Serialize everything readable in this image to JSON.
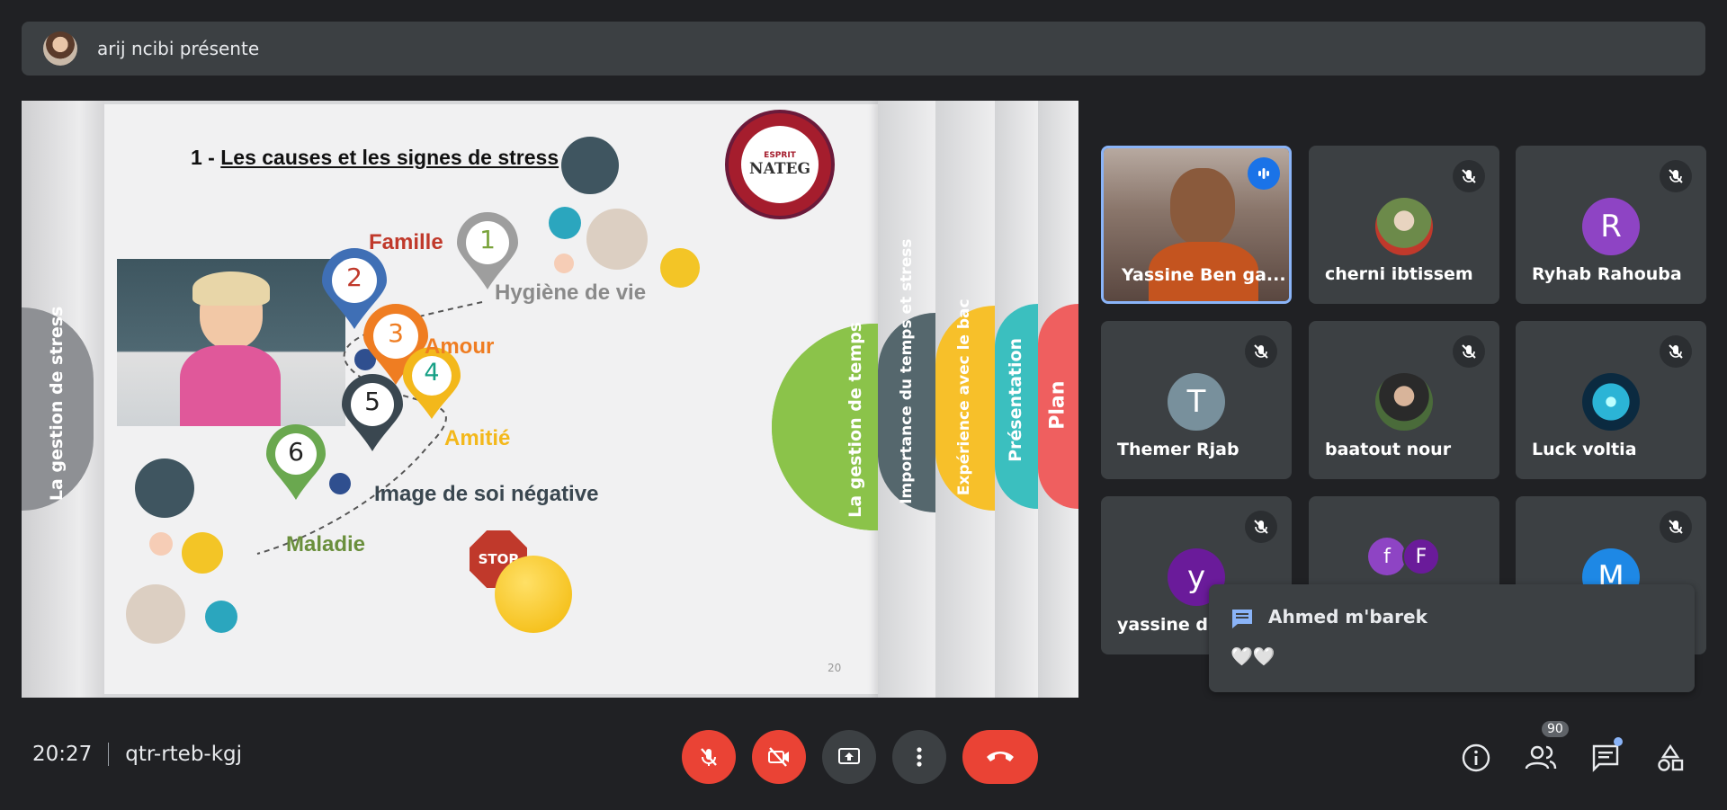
{
  "banner": {
    "presenter_text": "arij ncibi présente"
  },
  "slide": {
    "number_prefix": "1 - ",
    "title": "Les causes et les signes de stress",
    "badge_lines": [
      "ESPRIT",
      "NATEG"
    ],
    "side_tabs": [
      "La gestion de stress",
      "La gestion de temps",
      "Importance du temps et stress",
      "Expérience avec le bac",
      "Présentation",
      "Plan"
    ],
    "pins": [
      {
        "n": "1",
        "label": "Hygiène de vie",
        "color": "#9e9e9e"
      },
      {
        "n": "2",
        "label": "Famille",
        "color": "#3f6fb5"
      },
      {
        "n": "3",
        "label": "Amour",
        "color": "#ef7d22"
      },
      {
        "n": "4",
        "label": "Amitié",
        "color": "#f3b81b"
      },
      {
        "n": "5",
        "label": "Image de soi négative",
        "color": "#3a4750"
      },
      {
        "n": "6",
        "label": "Maladie",
        "color": "#6aa84f"
      }
    ],
    "stop_text": "STOP",
    "page_number": "20"
  },
  "participants": [
    {
      "name": "Yassine Ben ga...",
      "speaking": true
    },
    {
      "name": "cherni ibtissem",
      "muted": true
    },
    {
      "name": "Ryhab Rahouba",
      "initial": "R",
      "color": "#8e44c4",
      "muted": true
    },
    {
      "name": "Themer Rjab",
      "initial": "T",
      "color": "#78909c",
      "muted": true
    },
    {
      "name": "baatout nour",
      "muted": true
    },
    {
      "name": "Luck voltia",
      "muted": true
    },
    {
      "name": "yassine dr",
      "initial": "y",
      "color": "#6a1b9a",
      "muted": true
    },
    {
      "name": "",
      "initials": [
        "f",
        "F"
      ]
    },
    {
      "name": "",
      "initial": "M",
      "color": "#1e88e5",
      "muted": true
    }
  ],
  "chat_notification": {
    "sender": "Ahmed m'barek",
    "message": "🤍🤍"
  },
  "bottom_bar": {
    "time": "20:27",
    "meeting_code": "qtr-rteb-kgj",
    "people_count": "90"
  },
  "colors": {
    "end_call": "#ea4335",
    "mute_red": "#ea4335",
    "control_dark": "#3c4043",
    "speaking_border": "#8ab4f8"
  }
}
